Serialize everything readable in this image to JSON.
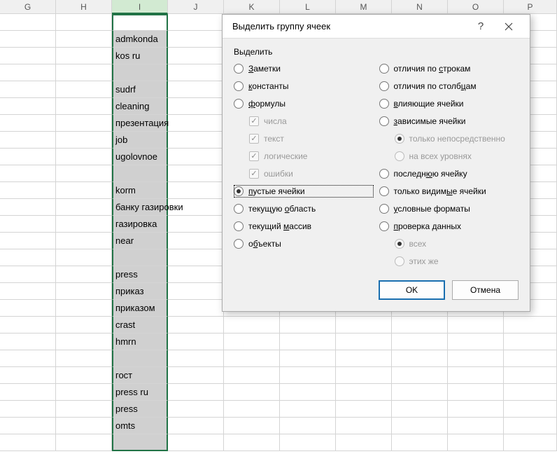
{
  "columns": [
    "G",
    "H",
    "I",
    "J",
    "K",
    "L",
    "M",
    "N",
    "O",
    "P"
  ],
  "selected_col": "I",
  "column_I_rows": [
    "",
    "admkonda",
    "kos ru",
    "",
    "sudrf",
    "cleaning",
    "презентация",
    "job",
    "ugolovnoe",
    "",
    "korm",
    "банку газировки",
    "газировка",
    "near",
    "",
    "press",
    "приказ",
    "приказом",
    "crast",
    "hmrn",
    "",
    "гост",
    "press ru",
    "press",
    "omts",
    ""
  ],
  "dialog": {
    "title": "Выделить группу ячеек",
    "group_label": "Выделить",
    "left_options": [
      {
        "type": "radio",
        "label": "Заметки",
        "accel": "З"
      },
      {
        "type": "radio",
        "label": "константы",
        "accel": "к"
      },
      {
        "type": "radio",
        "label": "формулы",
        "accel": "ф"
      },
      {
        "type": "check",
        "label": "числа",
        "disabled": true,
        "checked": true,
        "indent": true
      },
      {
        "type": "check",
        "label": "текст",
        "disabled": true,
        "checked": true,
        "indent": true
      },
      {
        "type": "check",
        "label": "логические",
        "disabled": true,
        "checked": true,
        "indent": true
      },
      {
        "type": "check",
        "label": "ошибки",
        "disabled": true,
        "checked": true,
        "indent": true
      },
      {
        "type": "radio",
        "label": "пустые ячейки",
        "accel": "п",
        "selected": true,
        "outline": true
      },
      {
        "type": "radio",
        "label": "текущую область",
        "accel": "о"
      },
      {
        "type": "radio",
        "label": "текущий массив",
        "accel": "м"
      },
      {
        "type": "radio",
        "label": "объекты",
        "accel": "б"
      }
    ],
    "right_options": [
      {
        "type": "radio",
        "label": "отличия по строкам",
        "accel": "с"
      },
      {
        "type": "radio",
        "label": "отличия по столбцам",
        "accel": "ц"
      },
      {
        "type": "radio",
        "label": "влияющие ячейки",
        "accel": "в"
      },
      {
        "type": "radio",
        "label": "зависимые ячейки",
        "accel": "з"
      },
      {
        "type": "radio",
        "label": "только непосредственно",
        "disabled": true,
        "selected": true,
        "indent": true
      },
      {
        "type": "radio",
        "label": "на всех уровнях",
        "disabled": true,
        "indent": true
      },
      {
        "type": "radio",
        "label": "последнюю ячейку",
        "accel": "ю"
      },
      {
        "type": "radio",
        "label": "только видимые ячейки",
        "accel": "ы"
      },
      {
        "type": "radio",
        "label": "условные форматы",
        "accel": "у"
      },
      {
        "type": "radio",
        "label": "проверка данных",
        "accel": "п"
      },
      {
        "type": "radio",
        "label": "всех",
        "disabled": true,
        "selected": true,
        "indent": true
      },
      {
        "type": "radio",
        "label": "этих же",
        "disabled": true,
        "indent": true
      }
    ],
    "ok": "OK",
    "cancel": "Отмена"
  }
}
